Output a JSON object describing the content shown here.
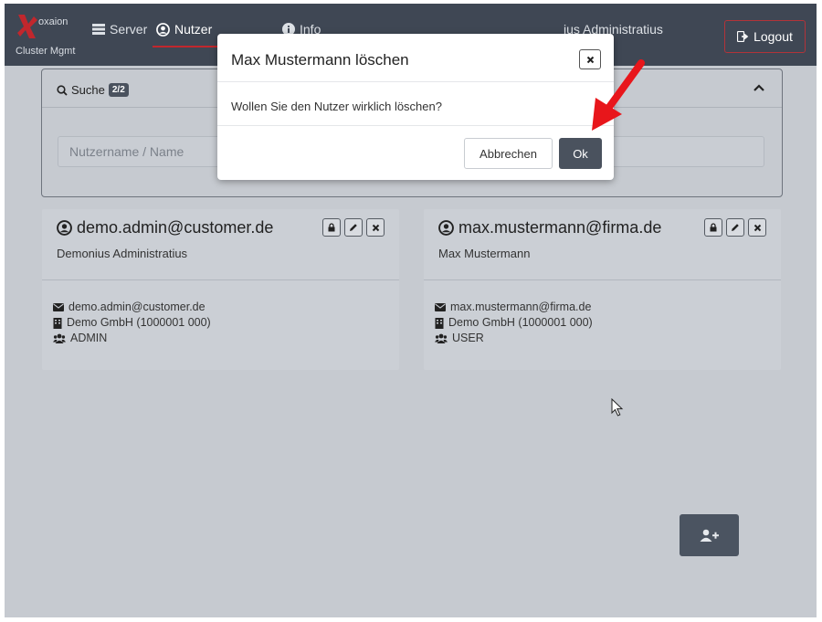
{
  "brand": {
    "name": "oxaion",
    "subtitle": "Cluster Mgmt"
  },
  "nav": {
    "server_label": "Server",
    "users_label": "Nutzer",
    "info_label": "Info",
    "current_user_label": "ius Administratius",
    "logout_label": "Logout"
  },
  "search": {
    "title": "Suche",
    "count": "2/2",
    "placeholder": "Nutzername / Name"
  },
  "users": [
    {
      "email_title": "demo.admin@customer.de",
      "name": "Demonius Administratius",
      "email": "demo.admin@customer.de",
      "company": "Demo GmbH (1000001 000)",
      "role": "ADMIN"
    },
    {
      "email_title": "max.mustermann@firma.de",
      "name": "Max Mustermann",
      "email": "max.mustermann@firma.de",
      "company": "Demo GmbH (1000001 000)",
      "role": "USER"
    }
  ],
  "modal": {
    "title": "Max Mustermann löschen",
    "body": "Wollen Sie den Nutzer wirklich löschen?",
    "cancel_label": "Abbrechen",
    "ok_label": "Ok"
  },
  "colors": {
    "navbar": "#3f4754",
    "accent_red": "#c1272d",
    "arrow_red": "#e8161b",
    "button_dark": "#4a525e"
  },
  "icons": [
    "list-icon",
    "user-circle-icon",
    "info-circle-icon",
    "logout-icon",
    "search-icon",
    "chevron-up-icon",
    "lock-icon",
    "pencil-icon",
    "close-icon",
    "envelope-icon",
    "building-icon",
    "users-icon",
    "add-user-icon"
  ]
}
